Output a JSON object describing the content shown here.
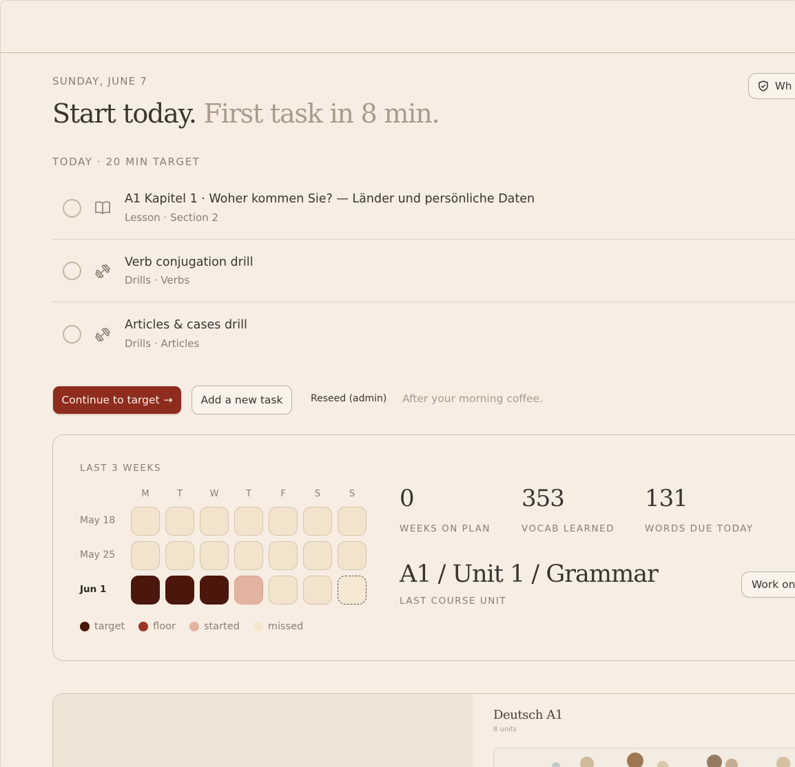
{
  "header": {
    "date": "SUNDAY, JUNE 7",
    "headline_main": "Start today.",
    "headline_sub": " First task in 8 min.",
    "top_pill_label": "Wh"
  },
  "today": {
    "section_label": "TODAY · 20 MIN TARGET",
    "tasks": [
      {
        "title": "A1 Kapitel 1 · Woher kommen Sie? — Länder und persönliche Daten",
        "meta": "Lesson · Section 2",
        "icon": "book-icon"
      },
      {
        "title": "Verb conjugation drill",
        "meta": "Drills · Verbs",
        "icon": "dumbbell-icon"
      },
      {
        "title": "Articles & cases drill",
        "meta": "Drills · Articles",
        "icon": "dumbbell-icon"
      }
    ]
  },
  "actions": {
    "continue_label": "Continue to target",
    "continue_arrow": "→",
    "add_task_label": "Add a new task",
    "reseed_label": "Reseed (admin)",
    "hint": "After your morning coffee."
  },
  "progress": {
    "label": "LAST 3 WEEKS",
    "day_heads": [
      "M",
      "T",
      "W",
      "T",
      "F",
      "S",
      "S"
    ],
    "weeks": [
      {
        "label": "May 18",
        "cells": [
          "missed",
          "missed",
          "missed",
          "missed",
          "missed",
          "missed",
          "missed"
        ]
      },
      {
        "label": "May 25",
        "cells": [
          "missed",
          "missed",
          "missed",
          "missed",
          "missed",
          "missed",
          "missed"
        ]
      },
      {
        "label": "Jun 1",
        "cells": [
          "target",
          "target",
          "target",
          "started",
          "missed",
          "missed",
          "today"
        ]
      }
    ],
    "legend": [
      {
        "label": "target",
        "color": "#4b160c"
      },
      {
        "label": "floor",
        "color": "#9a3424"
      },
      {
        "label": "started",
        "color": "#e3b3a2"
      },
      {
        "label": "missed",
        "color": "#f4e6cf"
      }
    ],
    "stats": [
      {
        "value": "0",
        "label": "WEEKS ON PLAN"
      },
      {
        "value": "353",
        "label": "VOCAB LEARNED"
      },
      {
        "value": "131",
        "label": "WORDS DUE TODAY"
      }
    ],
    "unit_title": "A1 / Unit 1 / Grammar",
    "unit_label": "LAST COURSE UNIT",
    "work_button": "Work on"
  },
  "course": {
    "title": "Deutsch A1",
    "subtitle": "8 units"
  },
  "colors": {
    "accent": "#8e2c1e",
    "background": "#f7ede2"
  }
}
